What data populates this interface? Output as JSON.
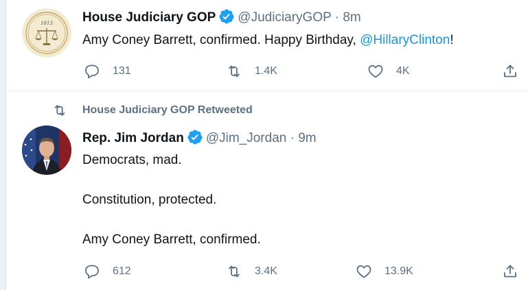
{
  "tweets": [
    {
      "author_name": "House Judiciary GOP",
      "handle": "@JudiciaryGOP",
      "separator": "·",
      "time": "8m",
      "verified": true,
      "seal_year": "1813",
      "text_main": "Amy Coney Barrett, confirmed. Happy Birthday, ",
      "text_mention": "@HillaryClinton",
      "text_end": "!",
      "replies": "131",
      "retweets": "1.4K",
      "likes": "4K"
    },
    {
      "retweet_context": "House Judiciary GOP Retweeted",
      "author_name": "Rep. Jim Jordan",
      "handle": "@Jim_Jordan",
      "separator": "·",
      "time": "9m",
      "verified": true,
      "paragraphs": [
        "Democrats, mad.",
        "Constitution, protected.",
        "Amy Coney Barrett, confirmed."
      ],
      "replies": "612",
      "retweets": "3.4K",
      "likes": "13.9K"
    }
  ],
  "colors": {
    "text": "#0f1419",
    "secondary": "#5b7083",
    "link": "#1b95e0",
    "verified": "#1da1f2",
    "divider": "#e6ecf0"
  }
}
